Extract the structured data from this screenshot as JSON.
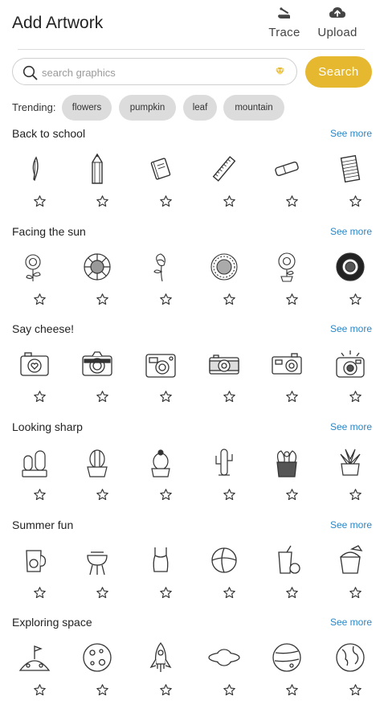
{
  "header": {
    "title": "Add Artwork",
    "trace_label": "Trace",
    "upload_label": "Upload"
  },
  "search": {
    "placeholder": "search graphics",
    "button_label": "Search"
  },
  "trending": {
    "label": "Trending:",
    "chips": [
      "flowers",
      "pumpkin",
      "leaf",
      "mountain"
    ]
  },
  "sections": [
    {
      "title": "Back to school",
      "see_more": "See more",
      "icons": [
        "feather-quill-icon",
        "pencil-icon",
        "notebook-icon",
        "ruler-icon",
        "eraser-icon",
        "lined-paper-icon"
      ]
    },
    {
      "title": "Facing the sun",
      "see_more": "See more",
      "icons": [
        "sunflower-with-leaves-icon",
        "sunflower-head-icon",
        "sunflower-stem-icon",
        "sun-daisy-icon",
        "sunflower-in-pot-icon",
        "black-sunflower-icon"
      ]
    },
    {
      "title": "Say cheese!",
      "see_more": "See more",
      "icons": [
        "heart-camera-icon",
        "photo-camera-icon",
        "instant-camera-icon",
        "retro-camera-icon",
        "film-camera-icon",
        "flash-camera-icon"
      ]
    },
    {
      "title": "Looking sharp",
      "see_more": "See more",
      "icons": [
        "cactus-pair-icon",
        "round-cactus-pot-icon",
        "flowering-cactus-icon",
        "saguaro-cactus-icon",
        "cactus-flowers-pot-icon",
        "aloe-pot-icon"
      ]
    },
    {
      "title": "Summer fun",
      "see_more": "See more",
      "icons": [
        "lemonade-pitcher-icon",
        "grill-icon",
        "swimsuit-icon",
        "beach-ball-icon",
        "drink-cup-icon",
        "sand-bucket-icon"
      ]
    },
    {
      "title": "Exploring space",
      "see_more": "See more",
      "icons": [
        "moon-flag-icon",
        "moon-icon",
        "rocket-icon",
        "saturn-icon",
        "planet-icon",
        "earth-icon"
      ]
    }
  ]
}
